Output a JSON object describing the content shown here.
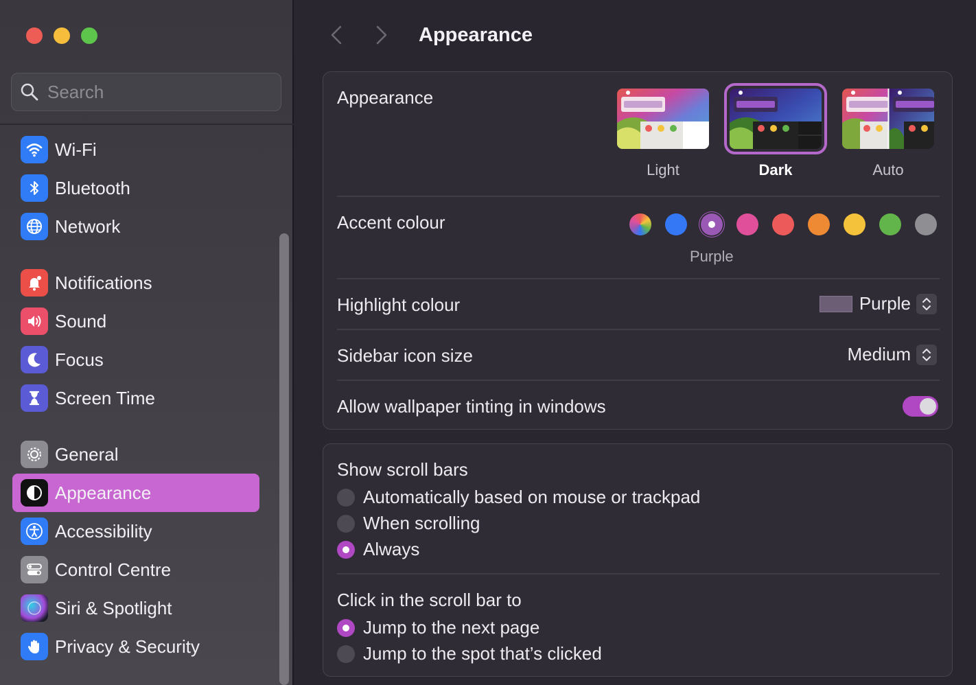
{
  "window": {
    "title": "Appearance"
  },
  "search": {
    "placeholder": "Search"
  },
  "sidebar": {
    "groups": [
      [
        {
          "label": "Wi-Fi",
          "icon": "wifi-icon"
        },
        {
          "label": "Bluetooth",
          "icon": "bluetooth-icon"
        },
        {
          "label": "Network",
          "icon": "globe-icon"
        }
      ],
      [
        {
          "label": "Notifications",
          "icon": "bell-icon"
        },
        {
          "label": "Sound",
          "icon": "speaker-icon"
        },
        {
          "label": "Focus",
          "icon": "moon-icon"
        },
        {
          "label": "Screen Time",
          "icon": "hourglass-icon"
        }
      ],
      [
        {
          "label": "General",
          "icon": "gear-icon"
        },
        {
          "label": "Appearance",
          "icon": "appearance-icon",
          "active": true
        },
        {
          "label": "Accessibility",
          "icon": "accessibility-icon"
        },
        {
          "label": "Control Centre",
          "icon": "toggles-icon"
        },
        {
          "label": "Siri & Spotlight",
          "icon": "siri-icon"
        },
        {
          "label": "Privacy & Security",
          "icon": "hand-icon"
        }
      ]
    ]
  },
  "appearance": {
    "label": "Appearance",
    "options": [
      {
        "label": "Light",
        "selected": false
      },
      {
        "label": "Dark",
        "selected": true
      },
      {
        "label": "Auto",
        "selected": false
      }
    ]
  },
  "accent": {
    "label": "Accent colour",
    "selected_name": "Purple",
    "colors": [
      "multicolor",
      "#3478f6",
      "#9b59b6",
      "#e0509a",
      "#ec5a5a",
      "#ee8a34",
      "#f5c33b",
      "#62b54a",
      "#8e8e93"
    ]
  },
  "highlight": {
    "label": "Highlight colour",
    "value": "Purple",
    "swatch_color": "#6c5e74"
  },
  "sidebar_icon_size": {
    "label": "Sidebar icon size",
    "value": "Medium"
  },
  "wallpaper_tinting": {
    "label": "Allow wallpaper tinting in windows",
    "enabled": true
  },
  "scroll_bars": {
    "label": "Show scroll bars",
    "options": [
      {
        "label": "Automatically based on mouse or trackpad",
        "selected": false
      },
      {
        "label": "When scrolling",
        "selected": false
      },
      {
        "label": "Always",
        "selected": true
      }
    ]
  },
  "scroll_click": {
    "label": "Click in the scroll bar to",
    "options": [
      {
        "label": "Jump to the next page",
        "selected": true
      },
      {
        "label": "Jump to the spot that’s clicked",
        "selected": false
      }
    ]
  },
  "colors": {
    "accent": "#c867d2",
    "toggle_on": "#b048c4"
  }
}
